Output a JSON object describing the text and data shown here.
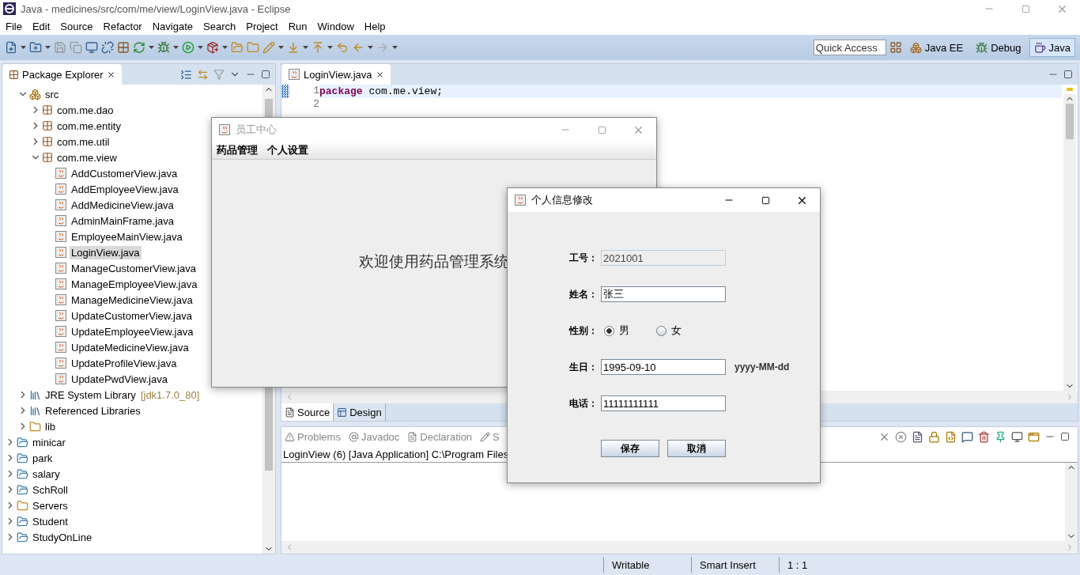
{
  "window": {
    "title": "Java - medicines/src/com/me/view/LoginView.java - Eclipse"
  },
  "menu": [
    "File",
    "Edit",
    "Source",
    "Refactor",
    "Navigate",
    "Search",
    "Project",
    "Run",
    "Window",
    "Help"
  ],
  "quick_access": {
    "placeholder": "Quick Access"
  },
  "perspectives": [
    {
      "label": "Java EE",
      "selected": false
    },
    {
      "label": "Debug",
      "selected": false
    },
    {
      "label": "Java",
      "selected": true
    }
  ],
  "package_explorer": {
    "title": "Package Explorer",
    "project_items": [
      {
        "kind": "source",
        "label": "src",
        "expanded": true,
        "children": [
          {
            "kind": "package",
            "label": "com.me.dao",
            "expanded": false
          },
          {
            "kind": "package",
            "label": "com.me.entity",
            "expanded": false
          },
          {
            "kind": "package",
            "label": "com.me.util",
            "expanded": false
          },
          {
            "kind": "package",
            "label": "com.me.view",
            "expanded": true,
            "children": [
              {
                "kind": "file",
                "label": "AddCustomerView.java",
                "selected": false
              },
              {
                "kind": "file",
                "label": "AddEmployeeView.java",
                "selected": false
              },
              {
                "kind": "file",
                "label": "AddMedicineView.java",
                "selected": false
              },
              {
                "kind": "file",
                "label": "AdminMainFrame.java",
                "selected": false
              },
              {
                "kind": "file",
                "label": "EmployeeMainView.java",
                "selected": false
              },
              {
                "kind": "file",
                "label": "LoginView.java",
                "selected": true
              },
              {
                "kind": "file",
                "label": "ManageCustomerView.java",
                "selected": false
              },
              {
                "kind": "file",
                "label": "ManageEmployeeView.java",
                "selected": false
              },
              {
                "kind": "file",
                "label": "ManageMedicineView.java",
                "selected": false
              },
              {
                "kind": "file",
                "label": "UpdateCustomerView.java",
                "selected": false
              },
              {
                "kind": "file",
                "label": "UpdateEmployeeView.java",
                "selected": false
              },
              {
                "kind": "file",
                "label": "UpdateMedicineView.java",
                "selected": false
              },
              {
                "kind": "file",
                "label": "UpdateProfileView.java",
                "selected": false
              },
              {
                "kind": "file",
                "label": "UpdatePwdView.java",
                "selected": false
              }
            ]
          }
        ]
      },
      {
        "kind": "library",
        "label": "JRE System Library",
        "decoration": "[jdk1.7.0_80]",
        "expanded": false
      },
      {
        "kind": "library",
        "label": "Referenced Libraries",
        "expanded": false
      },
      {
        "kind": "folder",
        "label": "lib",
        "expanded": false
      }
    ],
    "projects": [
      {
        "kind": "project",
        "label": "minicar",
        "expanded": false
      },
      {
        "kind": "project",
        "label": "park",
        "expanded": false
      },
      {
        "kind": "project",
        "label": "salary",
        "expanded": false
      },
      {
        "kind": "project",
        "label": "SchRoll",
        "expanded": false
      },
      {
        "kind": "folder",
        "label": "Servers",
        "expanded": false
      },
      {
        "kind": "project",
        "label": "Student",
        "expanded": false
      },
      {
        "kind": "project",
        "label": "StudyOnLine",
        "expanded": false
      }
    ]
  },
  "editor": {
    "tab": "LoginView.java",
    "lines": [
      {
        "number": "1",
        "keyword": "package",
        "code": " com.me.view;",
        "current": true
      },
      {
        "number": "2",
        "current": false
      }
    ],
    "bottom_tabs": [
      {
        "label": "Source",
        "selected": true
      },
      {
        "label": "Design",
        "selected": false
      }
    ]
  },
  "bottom_panel": {
    "tabs": [
      {
        "label": "Problems"
      },
      {
        "label": "Javadoc"
      },
      {
        "label": "Declaration"
      },
      {
        "label": "S"
      }
    ],
    "console_title": "LoginView (6) [Java Application] C:\\Program Files"
  },
  "status_bar": [
    "Writable",
    "Smart Insert",
    "1 : 1"
  ],
  "employee_window": {
    "title": "员工中心",
    "active": false,
    "menu": [
      "药品管理",
      "个人设置"
    ],
    "welcome": "欢迎使用药品管理系统"
  },
  "profile_dialog": {
    "title": "个人信息修改",
    "active": true,
    "fields": [
      {
        "kind": "text",
        "label": "工号：",
        "value": "2021001",
        "disabled": true
      },
      {
        "kind": "text",
        "label": "姓名：",
        "value": "张三",
        "disabled": false
      },
      {
        "kind": "radio",
        "label": "性别：",
        "options": [
          {
            "label": "男",
            "selected": true
          },
          {
            "label": "女",
            "selected": false
          }
        ]
      },
      {
        "kind": "text",
        "label": "生日：",
        "value": "1995-09-10",
        "disabled": false,
        "hint": "yyyy-MM-dd"
      },
      {
        "kind": "text",
        "label": "电话：",
        "value": "11111111111",
        "disabled": false
      }
    ],
    "buttons": [
      "保存",
      "取消"
    ]
  }
}
